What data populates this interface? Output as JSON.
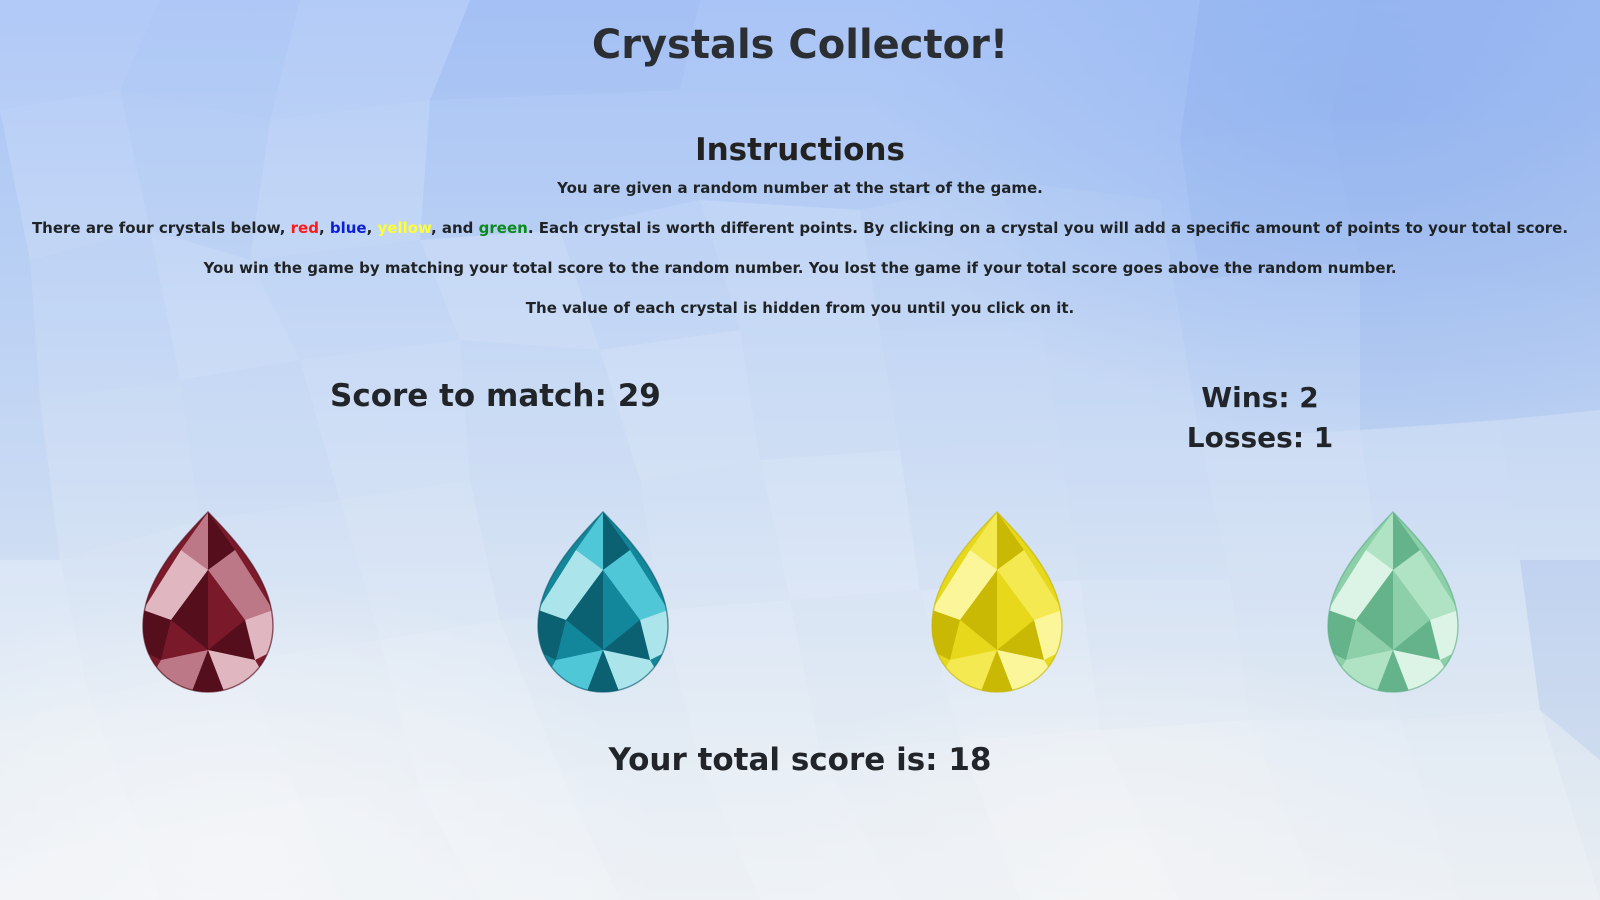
{
  "title": "Crystals Collector!",
  "instructions": {
    "heading": "Instructions",
    "line1": "You are given a random number at the start of the game.",
    "line2": {
      "prefix": "There are four crystals below, ",
      "red": "red",
      "sep1": ", ",
      "blue": "blue",
      "sep2": ", ",
      "yellow": "yellow",
      "sep3": ", and ",
      "green": "green",
      "suffix": ". Each crystal is worth different points. By clicking on a crystal you will add a specific amount of points to your total score."
    },
    "line3": "You win the game by matching your total score to the random number. You lost the game if your total score goes above the random number.",
    "line4": "The value of each crystal is hidden from you until you click on it."
  },
  "score_to_match": {
    "label": "Score to match: ",
    "value": "29"
  },
  "tally": {
    "wins_label": "Wins: ",
    "wins": "2",
    "losses_label": "Losses: ",
    "losses": "1"
  },
  "total_score": {
    "label": "Your total score is: ",
    "value": "18"
  },
  "crystals": [
    {
      "name": "red",
      "colors": {
        "base": "#7a1a2a",
        "dark": "#4f0d1a",
        "light": "#c98a98",
        "highlight": "#f2d2da"
      }
    },
    {
      "name": "blue",
      "colors": {
        "base": "#13869a",
        "dark": "#0a5a6a",
        "light": "#5cd2e2",
        "highlight": "#c8f4fa"
      }
    },
    {
      "name": "yellow",
      "colors": {
        "base": "#e6d81c",
        "dark": "#c4b400",
        "light": "#f6ec5a",
        "highlight": "#fffbb0"
      }
    },
    {
      "name": "green",
      "colors": {
        "base": "#8ccfa8",
        "dark": "#5eae86",
        "light": "#b6e6c8",
        "highlight": "#eafaf0"
      }
    }
  ],
  "colors": {
    "text": "#212529",
    "instruction_red": "#ff1a1a",
    "instruction_blue": "#0b1fd6",
    "instruction_yellow": "#ffff33",
    "instruction_green": "#0a8a1c"
  }
}
